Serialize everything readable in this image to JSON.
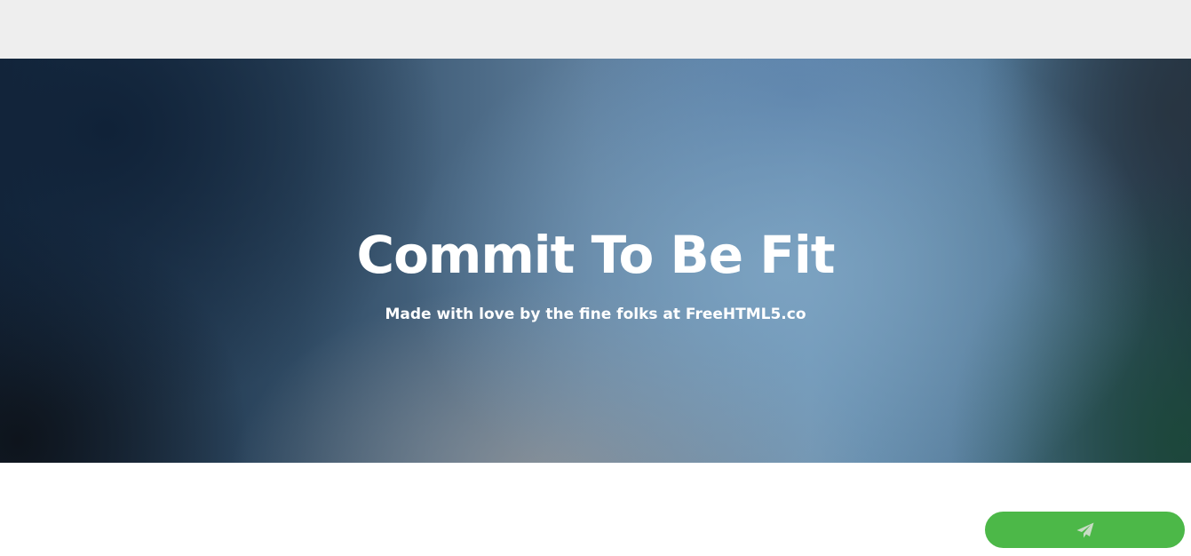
{
  "hero": {
    "title": "Commit To Be Fit",
    "subtitle": "Made with love by the fine folks at FreeHTML5.co"
  },
  "floating_button": {
    "icon": "paper-plane-icon",
    "color": "#4cb848",
    "icon_color": "#c8dcc4"
  },
  "colors": {
    "topbar": "#eeeeee",
    "hero_text": "#ffffff",
    "page_background": "#ffffff"
  }
}
